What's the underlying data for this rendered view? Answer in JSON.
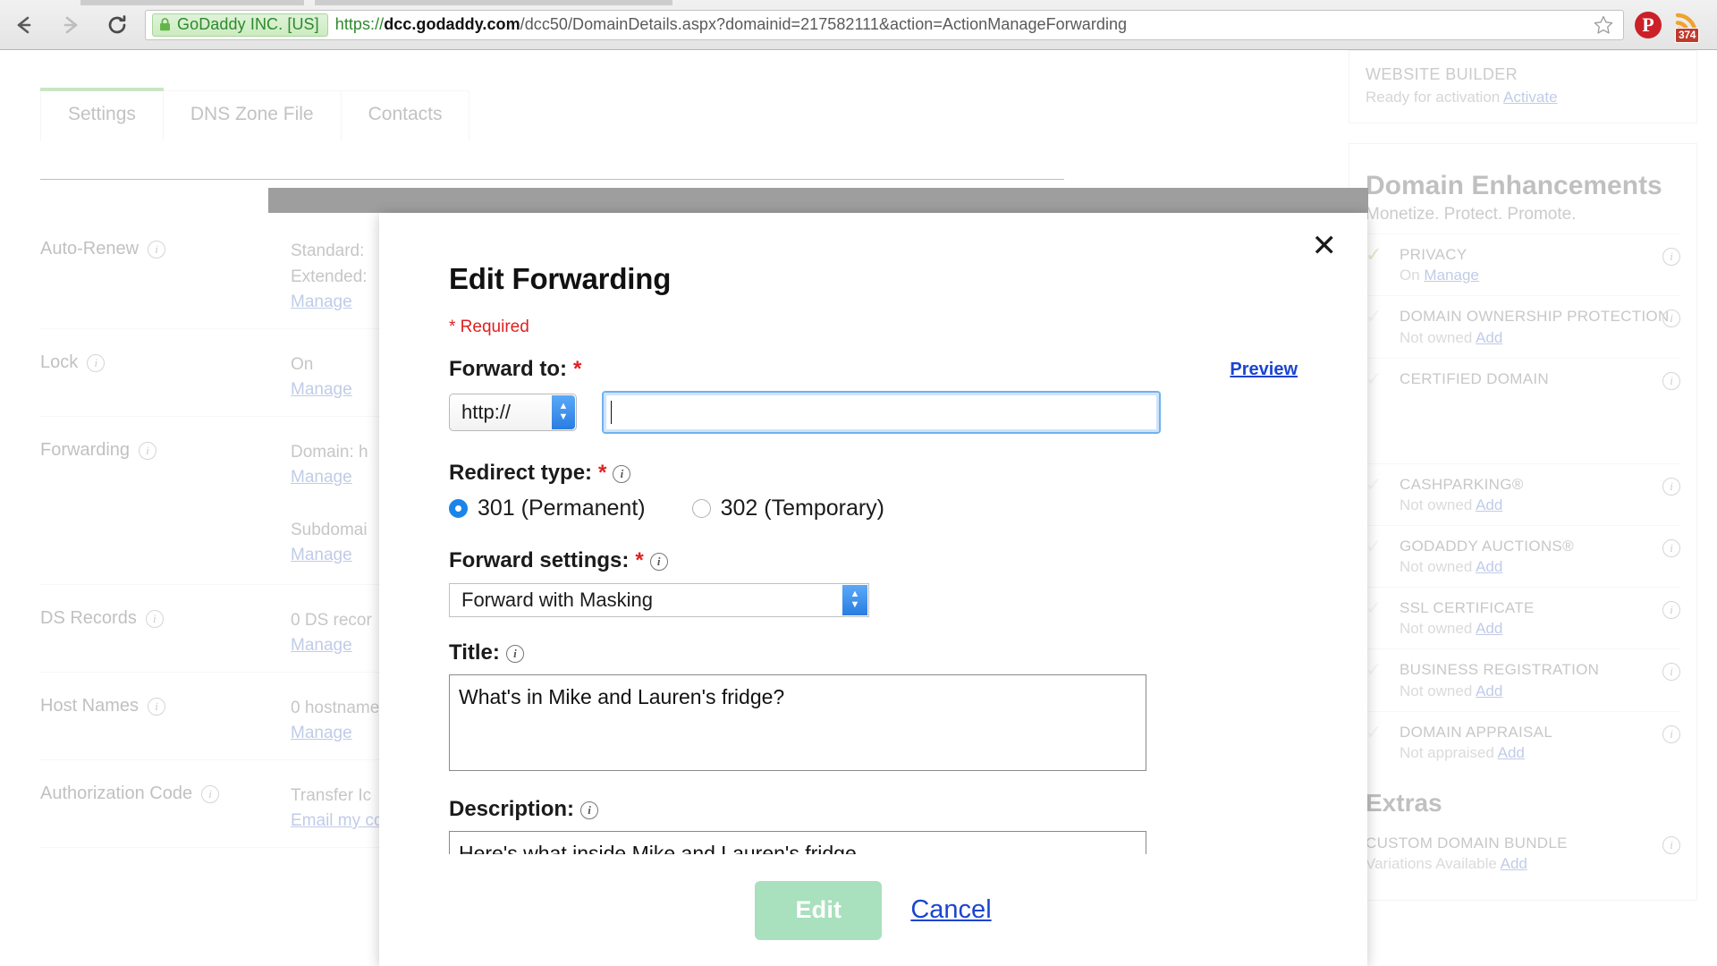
{
  "browser": {
    "back_icon": "back-arrow-icon",
    "forward_icon": "forward-arrow-icon",
    "reload_icon": "reload-icon",
    "security_label": "GoDaddy INC. [US]",
    "url_scheme": "https://",
    "url_host": "dcc.godaddy.com",
    "url_path": "/dcc50/DomainDetails.aspx?domainid=217582111&action=ActionManageForwarding",
    "url_full": "https://dcc.godaddy.com/dcc50/DomainDetails.aspx?domainid=217582111&action=ActionManageForwarding",
    "bookmark_icon": "star-icon",
    "extensions": [
      {
        "name": "pinterest-icon",
        "glyph": "P"
      },
      {
        "name": "rss-feed-icon",
        "badge": "374"
      }
    ]
  },
  "page": {
    "tabs": [
      {
        "label": "Settings",
        "active": true
      },
      {
        "label": "DNS Zone File",
        "active": false
      },
      {
        "label": "Contacts",
        "active": false
      }
    ],
    "rows": [
      {
        "label": "Auto-Renew",
        "values": [
          "Standard:",
          "Extended:"
        ],
        "link": "Manage"
      },
      {
        "label": "Lock",
        "values": [
          "On"
        ],
        "link": "Manage"
      },
      {
        "label": "Forwarding",
        "values": [
          "Domain: h"
        ],
        "link": "Manage",
        "values2": [
          "Subdomai"
        ],
        "link2": "Manage"
      },
      {
        "label": "DS Records",
        "values": [
          "0 DS recor"
        ],
        "link": "Manage"
      },
      {
        "label": "Host Names",
        "values": [
          "0 hostname"
        ],
        "link": "Manage"
      },
      {
        "label": "Authorization Code",
        "values": [
          "Transfer Ic"
        ],
        "link": "Email my co"
      }
    ],
    "sidebar": {
      "website_builder": {
        "title": "WEBSITE BUILDER",
        "status": "Ready for activation",
        "action": "Activate"
      },
      "enhancements_heading": "Domain Enhancements",
      "enhancements_tagline": "Monetize. Protect. Promote.",
      "enhancements": [
        {
          "name": "PRIVACY",
          "status": "On",
          "action": "Manage",
          "owned": true
        },
        {
          "name": "DOMAIN OWNERSHIP PROTECTION",
          "status": "Not owned",
          "action": "Add",
          "owned": false
        },
        {
          "name": "CERTIFIED DOMAIN",
          "status": "",
          "action": "",
          "owned": false
        },
        {
          "name": "CASHPARKING®",
          "status": "Not owned",
          "action": "Add",
          "owned": false
        },
        {
          "name": "GODADDY AUCTIONS®",
          "status": "Not owned",
          "action": "Add",
          "owned": false
        },
        {
          "name": "SSL CERTIFICATE",
          "status": "Not owned",
          "action": "Add",
          "owned": false
        },
        {
          "name": "BUSINESS REGISTRATION",
          "status": "Not owned",
          "action": "Add",
          "owned": false
        },
        {
          "name": "DOMAIN APPRAISAL",
          "status": "Not appraised",
          "action": "Add",
          "owned": false
        }
      ],
      "extras_heading": "Extras",
      "extras": [
        {
          "name": "CUSTOM DOMAIN BUNDLE",
          "status": "Variations Available",
          "action": "Add"
        }
      ]
    }
  },
  "modal": {
    "title": "Edit Forwarding",
    "close_icon": "close-icon",
    "required_note": "* Required",
    "forward_to": {
      "label": "Forward to:",
      "required_mark": "*",
      "preview_link": "Preview",
      "protocol_value": "http://",
      "url_value": "",
      "url_placeholder": ""
    },
    "redirect_type": {
      "label": "Redirect type:",
      "required_mark": "*",
      "info_icon": "info-icon",
      "options": [
        {
          "label": "301 (Permanent)",
          "selected": true
        },
        {
          "label": "302 (Temporary)",
          "selected": false
        }
      ]
    },
    "forward_settings": {
      "label": "Forward settings:",
      "required_mark": "*",
      "info_icon": "info-icon",
      "value": "Forward with Masking"
    },
    "title_field": {
      "label": "Title:",
      "info_icon": "info-icon",
      "value": "What's in Mike and Lauren's fridge?"
    },
    "description_field": {
      "label": "Description:",
      "info_icon": "info-icon",
      "value": "Here's what inside Mike and Lauren's fridge."
    },
    "footer": {
      "submit_label": "Edit",
      "cancel_label": "Cancel"
    }
  },
  "colors": {
    "accent_green": "#4caf2f",
    "link_blue": "#1a45d0",
    "required_red": "#e02020",
    "radio_blue": "#1a84e8",
    "submit_disabled": "#a9e0bd",
    "secure_green": "#2d8a2d"
  }
}
